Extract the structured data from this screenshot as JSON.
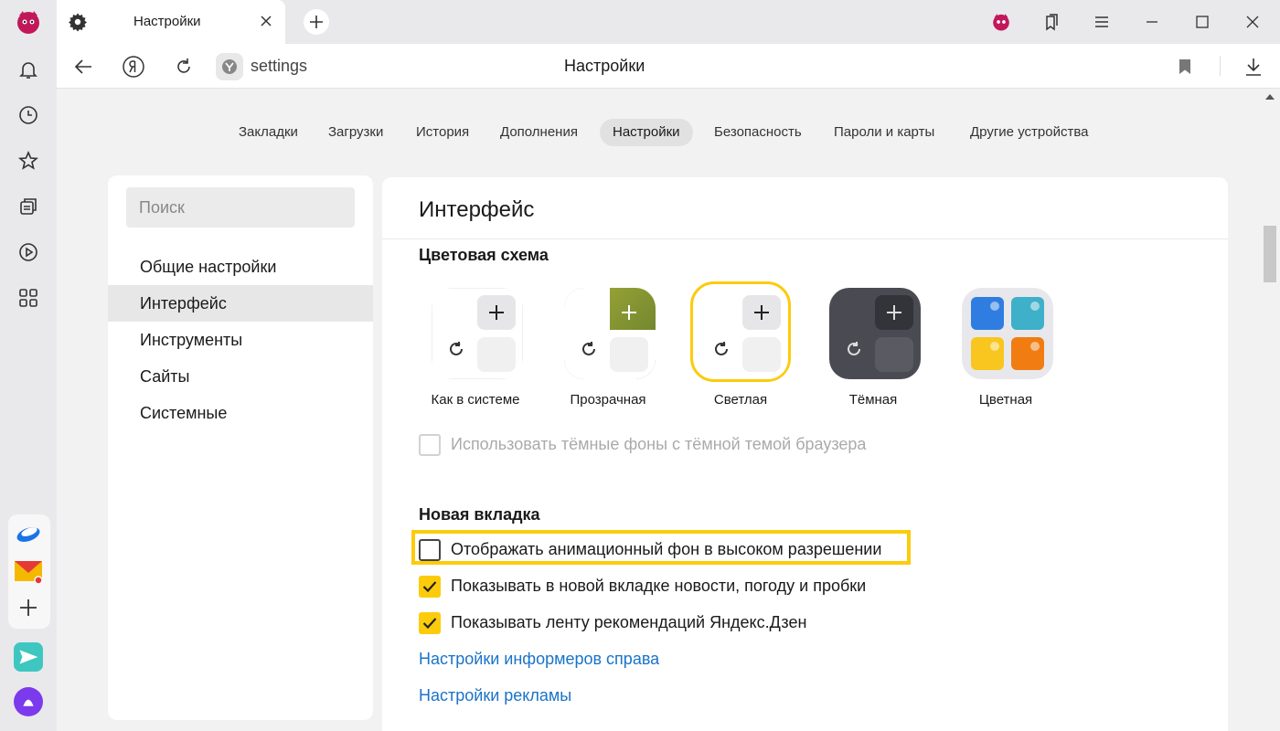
{
  "tab": {
    "title": "Настройки"
  },
  "address": {
    "url": "settings",
    "page_title": "Настройки"
  },
  "topnav": [
    "Закладки",
    "Загрузки",
    "История",
    "Дополнения",
    "Настройки",
    "Безопасность",
    "Пароли и карты",
    "Другие устройства"
  ],
  "topnav_active": "Настройки",
  "left_panel": {
    "search_placeholder": "Поиск",
    "items": [
      "Общие настройки",
      "Интерфейс",
      "Инструменты",
      "Сайты",
      "Системные"
    ],
    "active": "Интерфейс"
  },
  "main": {
    "header": "Интерфейс",
    "color_scheme": {
      "title": "Цветовая схема",
      "themes": [
        "Как в системе",
        "Прозрачная",
        "Светлая",
        "Тёмная",
        "Цветная"
      ],
      "selected": "Светлая",
      "dark_bg_option": {
        "label": "Использовать тёмные фоны с тёмной темой браузера",
        "checked": false,
        "disabled": true
      }
    },
    "new_tab": {
      "title": "Новая вкладка",
      "options": [
        {
          "label": "Отображать анимационный фон в высоком разрешении",
          "checked": false,
          "highlighted": true
        },
        {
          "label": "Показывать в новой вкладке новости, погоду и пробки",
          "checked": true
        },
        {
          "label": "Показывать ленту рекомендаций Яндекс.Дзен",
          "checked": true
        }
      ],
      "links": [
        "Настройки информеров справа",
        "Настройки рекламы"
      ]
    }
  },
  "colors": {
    "accent": "#fccb0b",
    "link": "#1a73c8"
  },
  "icons": {
    "sidebar": [
      "browser-logo-icon",
      "bell-icon",
      "clock-icon",
      "star-icon",
      "collections-icon",
      "play-icon",
      "apps-grid-icon",
      "disk-icon",
      "mail-icon",
      "add-icon",
      "messenger-icon",
      "alice-icon"
    ]
  }
}
